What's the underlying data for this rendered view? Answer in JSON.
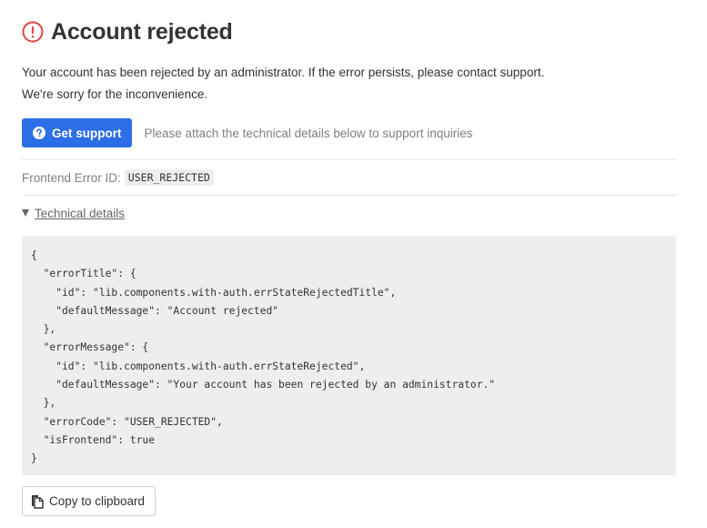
{
  "header": {
    "title": "Account rejected",
    "icon": "alert-circle-icon",
    "icon_color": "#e2453c"
  },
  "message": {
    "line1": "Your account has been rejected by an administrator. If the error persists, please contact support.",
    "line2": "We're sorry for the inconvenience."
  },
  "support": {
    "button_label": "Get support",
    "button_icon": "question-circle-icon",
    "button_color": "#2c6ee6",
    "hint": "Please attach the technical details below to support inquiries"
  },
  "error_id": {
    "label": "Frontend Error ID:",
    "value": "USER_REJECTED"
  },
  "details": {
    "toggle_label": "Technical details",
    "expanded": true,
    "code_lines": [
      "{",
      "  \"errorTitle\": {",
      "    \"id\": \"lib.components.with-auth.errStateRejectedTitle\",",
      "    \"defaultMessage\": \"Account rejected\"",
      "  },",
      "  \"errorMessage\": {",
      "    \"id\": \"lib.components.with-auth.errStateRejected\",",
      "    \"defaultMessage\": \"Your account has been rejected by an administrator.\"",
      "  },",
      "  \"errorCode\": \"USER_REJECTED\",",
      "  \"isFrontend\": true",
      "}"
    ]
  },
  "copy": {
    "button_label": "Copy to clipboard",
    "button_icon": "copy-icon"
  }
}
